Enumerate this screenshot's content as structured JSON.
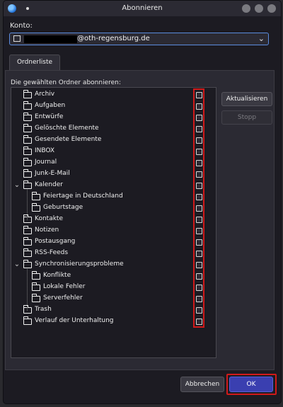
{
  "window": {
    "title": "Abonnieren"
  },
  "account": {
    "label": "Konto:",
    "value_suffix": "@oth-regensburg.de"
  },
  "tab": {
    "label": "Ordnerliste"
  },
  "tree": {
    "heading": "Die gewählten Ordner abonnieren:",
    "folders": [
      {
        "label": "Archiv",
        "level": 0,
        "expandable": false,
        "checked": false
      },
      {
        "label": "Aufgaben",
        "level": 0,
        "expandable": false,
        "checked": false
      },
      {
        "label": "Entwürfe",
        "level": 0,
        "expandable": false,
        "checked": false
      },
      {
        "label": "Gelöschte Elemente",
        "level": 0,
        "expandable": false,
        "checked": false
      },
      {
        "label": "Gesendete Elemente",
        "level": 0,
        "expandable": false,
        "checked": false
      },
      {
        "label": "INBOX",
        "level": 0,
        "expandable": false,
        "checked": false
      },
      {
        "label": "Journal",
        "level": 0,
        "expandable": false,
        "checked": false
      },
      {
        "label": "Junk-E-Mail",
        "level": 0,
        "expandable": false,
        "checked": false
      },
      {
        "label": "Kalender",
        "level": 0,
        "expandable": true,
        "checked": false
      },
      {
        "label": "Feiertage in Deutschland",
        "level": 1,
        "expandable": false,
        "checked": false
      },
      {
        "label": "Geburtstage",
        "level": 1,
        "expandable": false,
        "checked": false
      },
      {
        "label": "Kontakte",
        "level": 0,
        "expandable": false,
        "checked": false
      },
      {
        "label": "Notizen",
        "level": 0,
        "expandable": false,
        "checked": false
      },
      {
        "label": "Postausgang",
        "level": 0,
        "expandable": false,
        "checked": false
      },
      {
        "label": "RSS-Feeds",
        "level": 0,
        "expandable": false,
        "checked": false
      },
      {
        "label": "Synchronisierungsprobleme",
        "level": 0,
        "expandable": true,
        "checked": false
      },
      {
        "label": "Konflikte",
        "level": 1,
        "expandable": false,
        "checked": false
      },
      {
        "label": "Lokale Fehler",
        "level": 1,
        "expandable": false,
        "checked": false
      },
      {
        "label": "Serverfehler",
        "level": 1,
        "expandable": false,
        "checked": false
      },
      {
        "label": "Trash",
        "level": 0,
        "expandable": false,
        "checked": false
      },
      {
        "label": "Verlauf der Unterhaltung",
        "level": 0,
        "expandable": false,
        "checked": false
      }
    ]
  },
  "buttons": {
    "refresh": "Aktualisieren",
    "stop": "Stopp",
    "cancel": "Abbrechen",
    "ok": "OK"
  },
  "icons": {
    "app": "thunderbird-icon",
    "folder": "folder-icon",
    "expand": "chevron-down-icon",
    "dropdown": "chevron-down-icon"
  },
  "colors": {
    "accent": "#3a3fb0",
    "highlight": "#d11a1a",
    "background": "#1c1b22"
  }
}
